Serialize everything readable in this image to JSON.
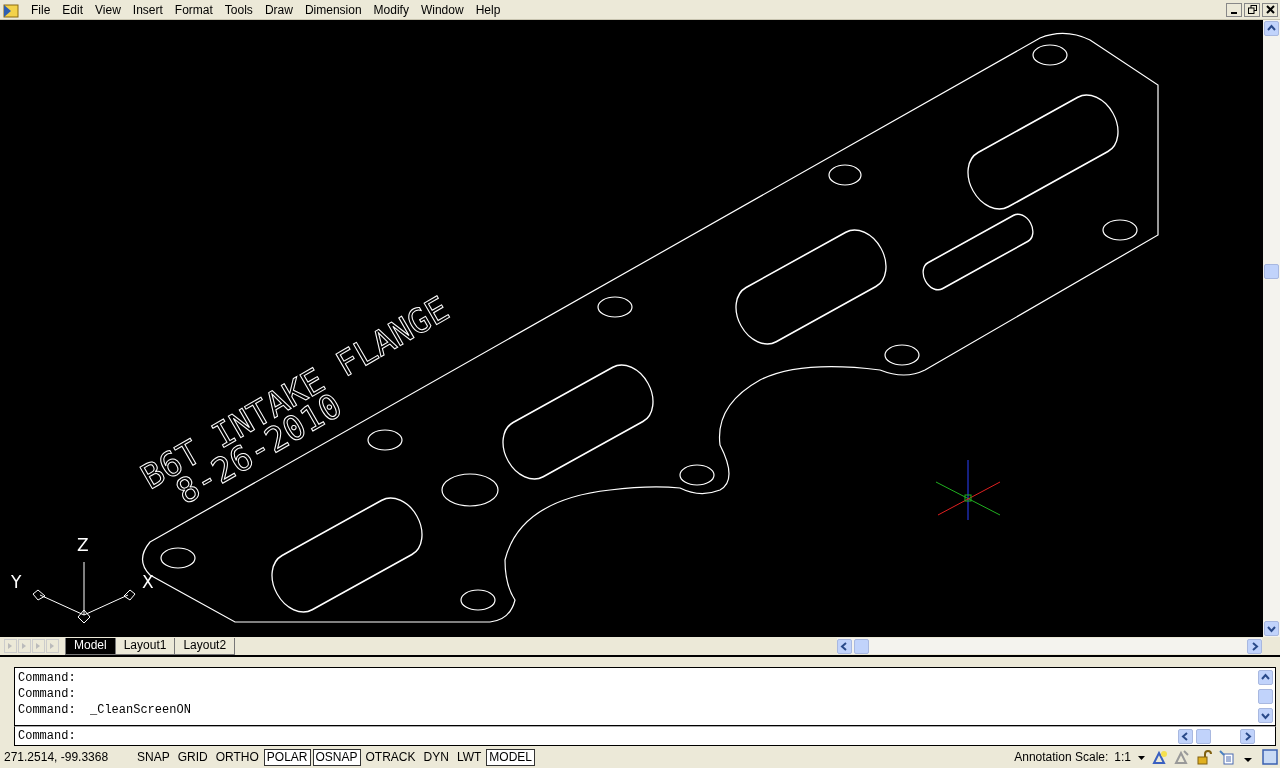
{
  "menu": [
    "File",
    "Edit",
    "View",
    "Insert",
    "Format",
    "Tools",
    "Draw",
    "Dimension",
    "Modify",
    "Window",
    "Help"
  ],
  "canvas": {
    "drawing_texts": [
      "B6T INTAKE FLANGE",
      "8-26-2010"
    ],
    "axis_labels": [
      "Z",
      "Y",
      "X"
    ]
  },
  "tabs": [
    {
      "label": "Model",
      "selected": true
    },
    {
      "label": "Layout1",
      "selected": false
    },
    {
      "label": "Layout2",
      "selected": false
    }
  ],
  "command_history": [
    "Command:",
    "Command:",
    "Command:  _CleanScreenON"
  ],
  "command_prompt": "Command:",
  "status_bar": {
    "coordinates": "271.2514, -99.3368",
    "toggles": [
      {
        "label": "SNAP",
        "on": false
      },
      {
        "label": "GRID",
        "on": false
      },
      {
        "label": "ORTHO",
        "on": false
      },
      {
        "label": "POLAR",
        "on": true
      },
      {
        "label": "OSNAP",
        "on": true
      },
      {
        "label": "OTRACK",
        "on": false
      },
      {
        "label": "DYN",
        "on": false
      },
      {
        "label": "LWT",
        "on": false
      },
      {
        "label": "MODEL",
        "on": true
      }
    ],
    "annotation_scale_label": "Annotation Scale:",
    "annotation_scale": "1:1"
  }
}
